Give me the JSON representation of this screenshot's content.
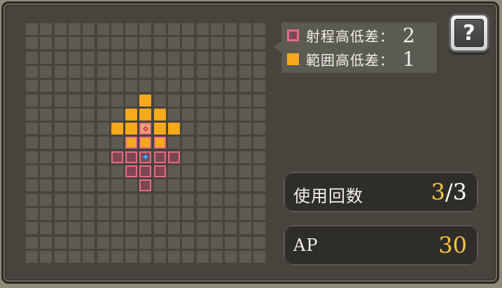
{
  "legend": {
    "range_label": "射程高低差：",
    "range_value": "2",
    "area_label": "範囲高低差：",
    "area_value": "1"
  },
  "help": {
    "glyph": "?",
    "icon": "question-book-icon"
  },
  "uses": {
    "label": "使用回数",
    "current": "3",
    "separator": "/",
    "max": "3"
  },
  "ap": {
    "label": "AP",
    "value": "30"
  },
  "colors": {
    "area": "#f7a91c",
    "range_border": "#e86a8b",
    "cell": "#5d5a52",
    "accent_gold": "#f2c445"
  },
  "grid_data": {
    "columns": 17,
    "rows": 17,
    "area_cells": [
      [
        8,
        5
      ],
      [
        7,
        6
      ],
      [
        8,
        6
      ],
      [
        9,
        6
      ],
      [
        6,
        7
      ],
      [
        7,
        7
      ],
      [
        9,
        7
      ],
      [
        10,
        7
      ]
    ],
    "range_area_cells": [
      [
        7,
        8
      ],
      [
        8,
        8
      ],
      [
        9,
        8
      ]
    ],
    "range_cells": [
      [
        6,
        9
      ],
      [
        7,
        9
      ],
      [
        9,
        9
      ],
      [
        10,
        9
      ],
      [
        7,
        10
      ],
      [
        8,
        10
      ],
      [
        9,
        10
      ],
      [
        8,
        11
      ]
    ],
    "target_cell": [
      8,
      7
    ],
    "caster_cell": [
      8,
      9
    ]
  }
}
